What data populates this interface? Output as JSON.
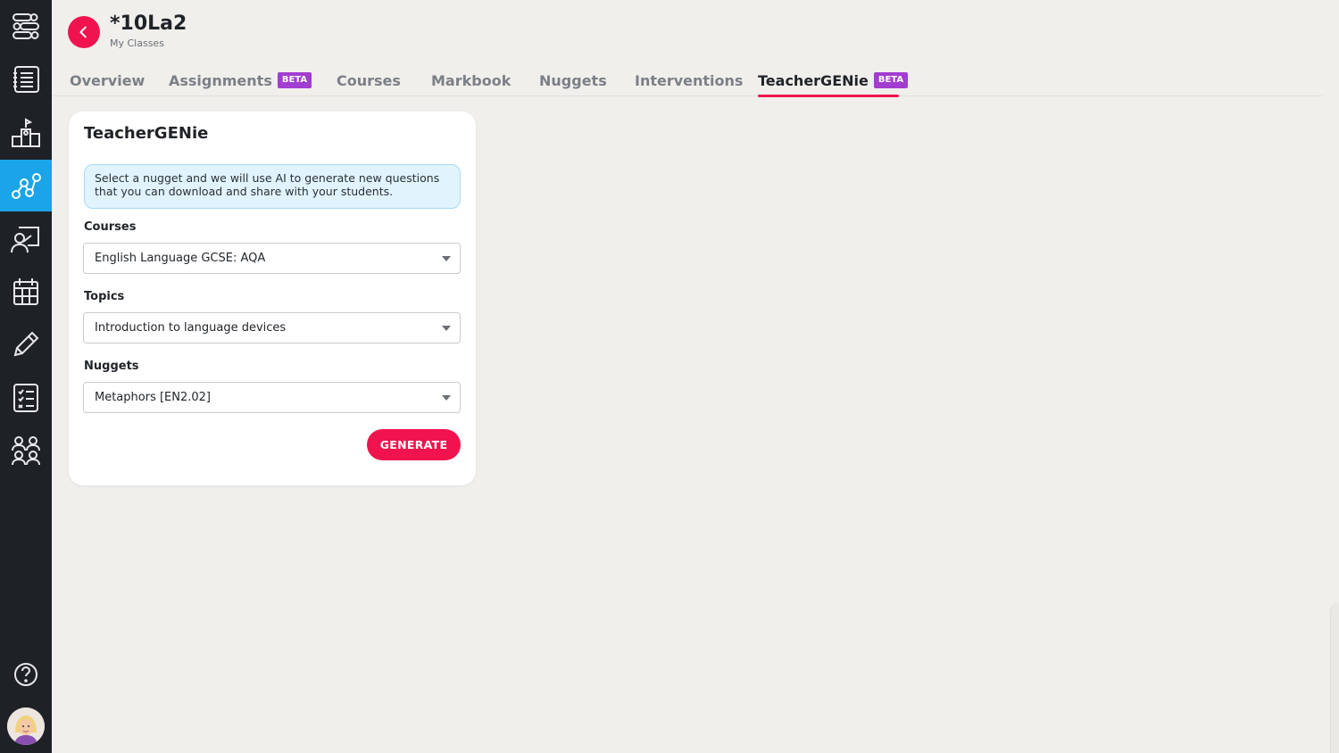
{
  "sidebar": {
    "items": [
      {
        "icon": "hierarchy-icon"
      },
      {
        "icon": "list-icon"
      },
      {
        "icon": "podium-icon"
      },
      {
        "icon": "network-icon",
        "active": true
      },
      {
        "icon": "teacher-board-icon"
      },
      {
        "icon": "calendar-icon"
      },
      {
        "icon": "pencil-icon"
      },
      {
        "icon": "checklist-icon"
      },
      {
        "icon": "group-icon"
      }
    ],
    "help_icon": "help-icon",
    "avatar_icon": "user-avatar"
  },
  "header": {
    "title": "*10La2",
    "subtitle": "My Classes"
  },
  "tabs": [
    {
      "label": "Overview"
    },
    {
      "label": "Assignments",
      "badge": "BETA"
    },
    {
      "label": "Courses"
    },
    {
      "label": "Markbook"
    },
    {
      "label": "Nuggets"
    },
    {
      "label": "Interventions"
    },
    {
      "label": "TeacherGENie",
      "badge": "BETA",
      "active": true
    }
  ],
  "card": {
    "title": "TeacherGENie",
    "info_line1": "Select a nugget and we will use AI to generate new questions",
    "info_line2": "that you can download and share with your students.",
    "courses_label": "Courses",
    "courses_value": "English Language GCSE: AQA",
    "topics_label": "Topics",
    "topics_value": "Introduction to language devices",
    "nuggets_label": "Nuggets",
    "nuggets_value": "Metaphors [EN2.02]",
    "generate_label": "GENERATE"
  },
  "colors": {
    "accent": "#f0134d",
    "sidebar_bg": "#1e2227",
    "sidebar_active": "#1ba4e8",
    "beta": "#a23dd1",
    "info_bg": "#e1f4fd"
  }
}
